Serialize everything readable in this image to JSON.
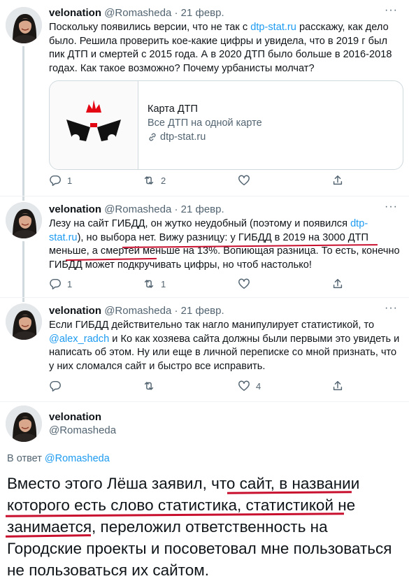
{
  "tweets": [
    {
      "name": "velonation",
      "handle": "@Romasheda",
      "date": "· 21 февр.",
      "text_parts": {
        "t1": "Поскольку появились версии, что не так с ",
        "link1": "dtp-stat.ru",
        "t2": " расскажу, как дело было. Решила проверить кое-какие цифры и увидела, что в 2019 г был пик ДТП и смертей с 2015 года.  А в 2020 ДТП было больше в 2016-2018 годах. Как такое возможно? Почему урбанисты молчат?"
      },
      "card": {
        "title": "Карта ДТП",
        "description": "Все ДТП на одной карте",
        "domain": "dtp-stat.ru"
      },
      "actions": {
        "replies": "1",
        "retweets": "2",
        "likes": ""
      }
    },
    {
      "name": "velonation",
      "handle": "@Romasheda",
      "date": "· 21 февр.",
      "text_parts": {
        "t1": "Лезу на сайт ГИБДД, он жутко неудобный (поэтому и появился ",
        "link1": "dtp-stat.ru",
        "t2": "), но выбора нет. Вижу разницу: у ГИБДД в 2019 на 3000 ДТП меньше, а смертей меньше на 13%. Вопиющая разница. То есть, конечно ГИБДД может подкручивать цифры, но чтоб настолько!"
      },
      "actions": {
        "replies": "1",
        "retweets": "1",
        "likes": ""
      }
    },
    {
      "name": "velonation",
      "handle": "@Romasheda",
      "date": "· 21 февр.",
      "text_parts": {
        "t1": "Если ГИБДД действительно так нагло манипулирует статистикой, то ",
        "link1": "@alex_radch",
        "t2": " и Ко как хозяева сайта должны были первыми это увидеть и написать об этом. Ну или еще в личной переписке со мной признать, что у них сломался сайт и быстро все исправить."
      },
      "actions": {
        "replies": "",
        "retweets": "",
        "likes": "4"
      }
    }
  ],
  "main_tweet": {
    "name": "velonation",
    "handle": "@Romasheda",
    "reply_prefix": "В ответ ",
    "reply_handle": "@Romasheda",
    "text": "Вместо этого Лёша заявил, что сайт, в названии которого есть слово статистика, статистикой не занимается, переложил ответственность на Городские проекты и посоветовал мне пользоваться не пользоваться их сайтом."
  },
  "more_label": "···",
  "colors": {
    "link": "#1d9bf0",
    "underline": "#c8102e",
    "muted": "#536471"
  },
  "icons": [
    "reply-icon",
    "retweet-icon",
    "like-icon",
    "share-icon",
    "more-icon",
    "link-icon"
  ]
}
